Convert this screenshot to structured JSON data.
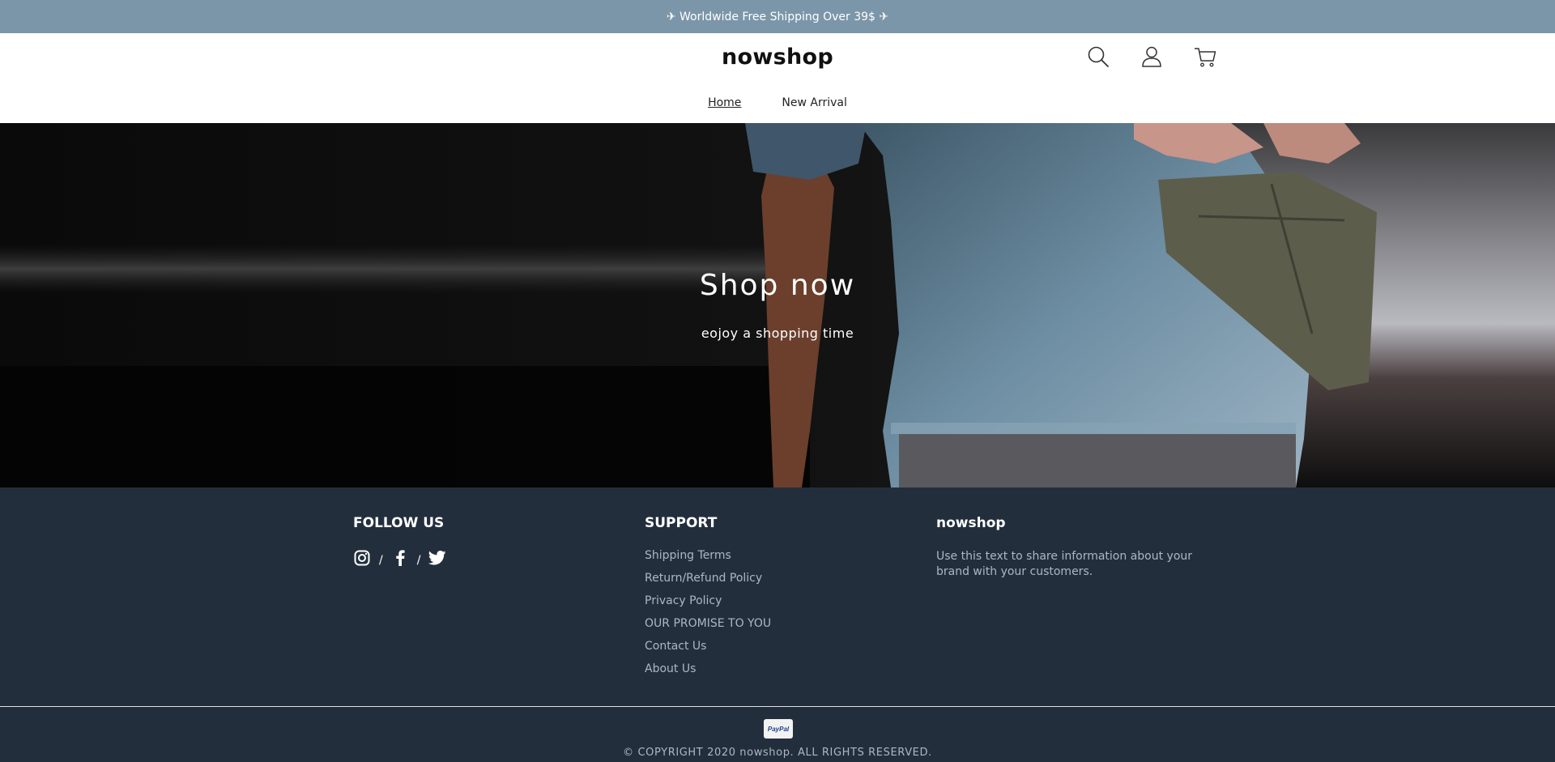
{
  "announcement": {
    "text": "✈ Worldwide Free Shipping Over 39$ ✈"
  },
  "header": {
    "logo": "nowshop",
    "icons": [
      "search-icon",
      "account-icon",
      "cart-icon"
    ],
    "nav": [
      {
        "label": "Home",
        "active": true
      },
      {
        "label": "New Arrival",
        "active": false
      }
    ]
  },
  "hero": {
    "title": "Shop now",
    "subtitle": "eojoy a shopping time"
  },
  "footer": {
    "follow": {
      "title": "FOLLOW US",
      "icons": [
        "instagram-icon",
        "facebook-icon",
        "twitter-icon"
      ],
      "separator": "/"
    },
    "support": {
      "title": "SUPPORT",
      "links": [
        "Shipping Terms",
        "Return/Refund Policy",
        "Privacy Policy",
        "OUR PROMISE TO YOU",
        "Contact Us",
        "About Us"
      ]
    },
    "brand": {
      "title": "nowshop",
      "text": "Use this text to share information about your brand with your customers."
    },
    "payment": {
      "label": "PayPal"
    },
    "copyright": "© COPYRIGHT 2020 nowshop. ALL RIGHTS RESERVED."
  },
  "colors": {
    "announcement_bg": "#7b96a9",
    "footer_bg": "#232e3d",
    "footer_link": "#aeb6c2"
  }
}
